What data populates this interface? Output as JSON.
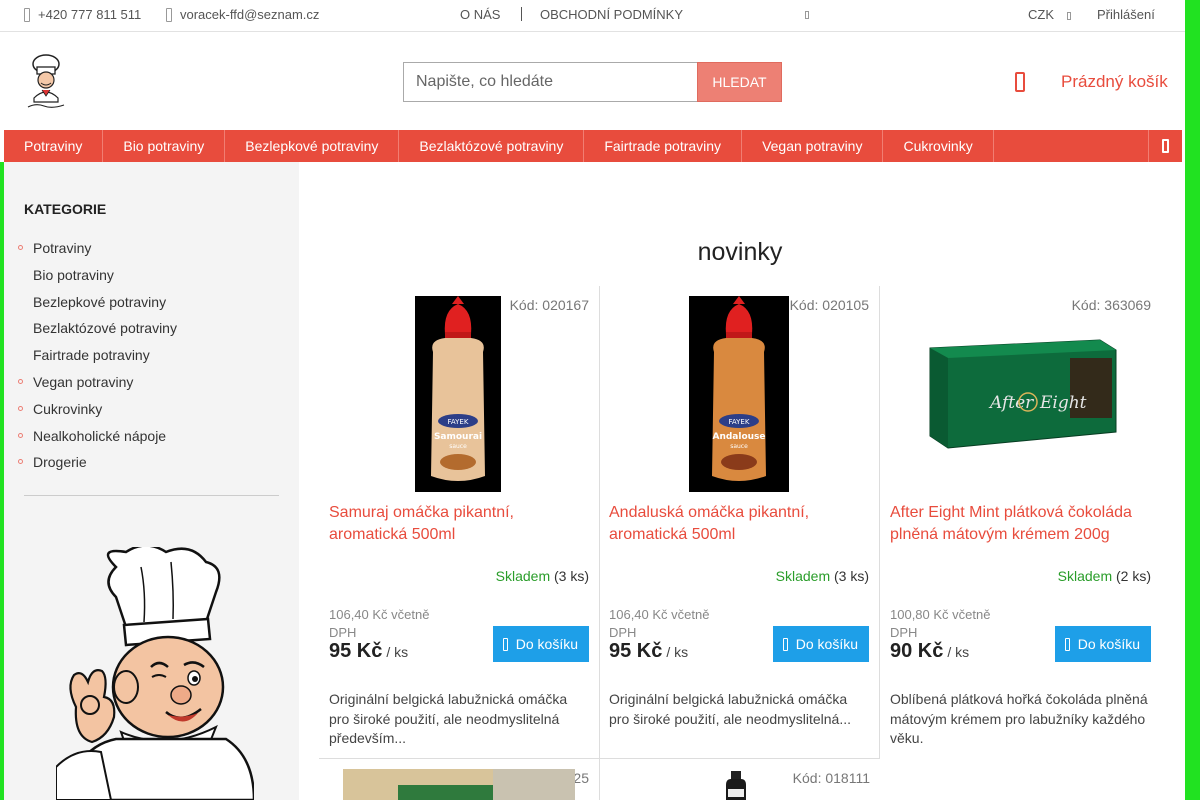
{
  "topbar": {
    "phone": "+420 777 811 511",
    "email": "voracek-ffd@seznam.cz",
    "about": "O NÁS",
    "terms": "OBCHODNÍ PODMÍNKY",
    "currency": "CZK",
    "login": "Přihlášení"
  },
  "search": {
    "placeholder": "Napište, co hledáte",
    "button": "HLEDAT"
  },
  "cart": {
    "label": "Prázdný košík"
  },
  "nav": {
    "items": [
      "Potraviny",
      "Bio potraviny",
      "Bezlepkové potraviny",
      "Bezlaktózové potraviny",
      "Fairtrade potraviny",
      "Vegan potraviny",
      "Cukrovinky"
    ]
  },
  "sidebar": {
    "title": "KATEGORIE",
    "categories": [
      {
        "label": "Potraviny",
        "bullet": true
      },
      {
        "label": "Bio potraviny",
        "bullet": false
      },
      {
        "label": "Bezlepkové potraviny",
        "bullet": false
      },
      {
        "label": "Bezlaktózové potraviny",
        "bullet": false
      },
      {
        "label": "Fairtrade potraviny",
        "bullet": false
      },
      {
        "label": "Vegan potraviny",
        "bullet": true
      },
      {
        "label": "Cukrovinky",
        "bullet": true
      },
      {
        "label": "Nealkoholické nápoje",
        "bullet": true
      },
      {
        "label": "Drogerie",
        "bullet": true
      }
    ]
  },
  "main": {
    "title": "novinky",
    "products": [
      {
        "code": "Kód: 020167",
        "name": "Samuraj omáčka pikantní, aromatická 500ml",
        "stock_status": "Skladem",
        "stock_qty": "(3 ks)",
        "vat_price": "106,40 Kč včetně DPH",
        "price": "95 Kč",
        "unit": "/ ks",
        "buy": "Do košíku",
        "desc": "Originální belgická labužnická omáčka pro široké použití, ale neodmyslitelná především..."
      },
      {
        "code": "Kód: 020105",
        "name": "Andaluská omáčka pikantní, aromatická 500ml",
        "stock_status": "Skladem",
        "stock_qty": "(3 ks)",
        "vat_price": "106,40 Kč včetně DPH",
        "price": "95 Kč",
        "unit": "/ ks",
        "buy": "Do košíku",
        "desc": "Originální belgická labužnická omáčka pro široké použití, ale neodmyslitelná..."
      },
      {
        "code": "Kód: 363069",
        "name": "After Eight Mint plátková čokoláda plněná mátovým krémem 200g",
        "stock_status": "Skladem",
        "stock_qty": "(2 ks)",
        "vat_price": "100,80 Kč včetně DPH",
        "price": "90 Kč",
        "unit": "/ ks",
        "buy": "Do košíku",
        "desc": "Oblíbená plátková hořká čokoláda plněná mátovým krémem pro labužníky každého věku."
      }
    ],
    "next_row_codes": [
      "Kód: 420025",
      "Kód: 018111"
    ]
  },
  "colors": {
    "accent": "#e84c3d",
    "buy_button": "#1e9fe8",
    "in_stock": "#2a9d2a",
    "page_border_green": "#21e221"
  }
}
